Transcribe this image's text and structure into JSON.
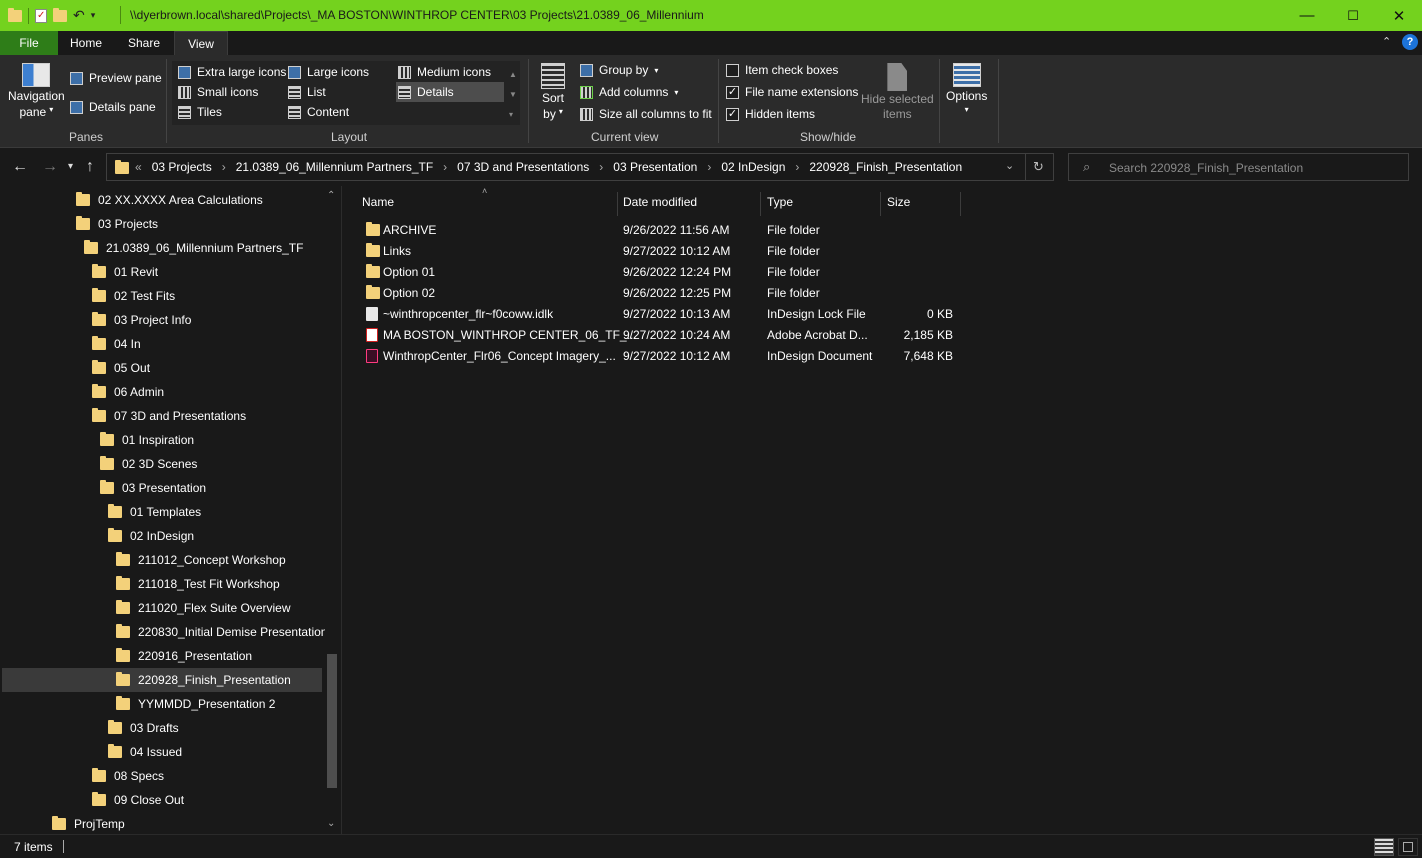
{
  "window": {
    "path": "\\\\dyerbrown.local\\shared\\Projects\\_MA BOSTON\\WINTHROP CENTER\\03 Projects\\21.0389_06_Millennium",
    "min": "—",
    "max": "☐",
    "close": "✕"
  },
  "tabs": {
    "file": "File",
    "home": "Home",
    "share": "Share",
    "view": "View"
  },
  "ribbon": {
    "panes": {
      "nav_label": "Navigation",
      "nav_label2": "pane",
      "preview": "Preview pane",
      "details": "Details pane",
      "group": "Panes"
    },
    "layout": {
      "xl_icons": "Extra large icons",
      "large_icons": "Large icons",
      "medium_icons": "Medium icons",
      "small_icons": "Small icons",
      "list": "List",
      "details": "Details",
      "tiles": "Tiles",
      "content": "Content",
      "group": "Layout"
    },
    "current_view": {
      "sort": "Sort",
      "sort2": "by",
      "group_by": "Group by",
      "add_columns": "Add columns",
      "size_all": "Size all columns to fit",
      "group": "Current view"
    },
    "show_hide": {
      "item_check": "Item check boxes",
      "file_ext": "File name extensions",
      "hidden": "Hidden items",
      "hide_selected": "Hide selected",
      "hide_selected2": "items",
      "options": "Options",
      "group": "Show/hide"
    }
  },
  "address": {
    "crumbs": [
      "03 Projects",
      "21.0389_06_Millennium Partners_TF",
      "07 3D and Presentations",
      "03 Presentation",
      "02 InDesign",
      "220928_Finish_Presentation"
    ],
    "search_placeholder": "Search 220928_Finish_Presentation"
  },
  "nav": [
    "02 XX.XXXX Area Calculations",
    "03 Projects",
    "21.0389_06_Millennium Partners_TF",
    "01 Revit",
    "02 Test Fits",
    "03 Project Info",
    "04 In",
    "05 Out",
    "06 Admin",
    "07 3D and Presentations",
    "01 Inspiration",
    "02 3D Scenes",
    "03 Presentation",
    "01 Templates",
    "02 InDesign",
    "211012_Concept Workshop",
    "211018_Test Fit Workshop",
    "211020_Flex Suite Overview",
    "220830_Initial Demise Presentation",
    "220916_Presentation",
    "220928_Finish_Presentation",
    "YYMMDD_Presentation 2",
    "03 Drafts",
    "04 Issued",
    "08 Specs",
    "09 Close Out",
    "ProjTemp"
  ],
  "columns": {
    "name": "Name",
    "date": "Date modified",
    "type": "Type",
    "size": "Size"
  },
  "files": [
    {
      "name": "ARCHIVE",
      "date": "9/26/2022 11:56 AM",
      "type": "File folder",
      "size": ""
    },
    {
      "name": "Links",
      "date": "9/27/2022 10:12 AM",
      "type": "File folder",
      "size": ""
    },
    {
      "name": "Option 01",
      "date": "9/26/2022 12:24 PM",
      "type": "File folder",
      "size": ""
    },
    {
      "name": "Option 02",
      "date": "9/26/2022 12:25 PM",
      "type": "File folder",
      "size": ""
    },
    {
      "name": "~winthropcenter_flr~f0coww.idlk",
      "date": "9/27/2022 10:13 AM",
      "type": "InDesign Lock File",
      "size": "0 KB"
    },
    {
      "name": "MA BOSTON_WINTHROP CENTER_06_TF_...",
      "date": "9/27/2022 10:24 AM",
      "type": "Adobe Acrobat D...",
      "size": "2,185 KB"
    },
    {
      "name": "WinthropCenter_Flr06_Concept Imagery_...",
      "date": "9/27/2022 10:12 AM",
      "type": "InDesign Document",
      "size": "7,648 KB"
    }
  ],
  "status": {
    "count": "7 items"
  },
  "colors": {
    "titlebar": "#74d21e",
    "file_tab": "#2e7d18",
    "folder": "#f3d17a"
  }
}
